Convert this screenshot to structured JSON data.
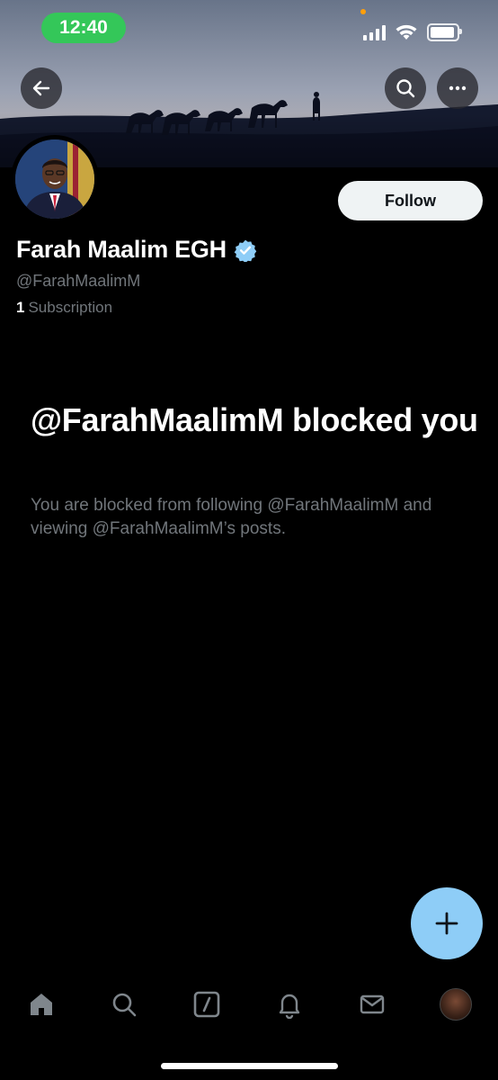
{
  "status_bar": {
    "time": "12:40",
    "icons": [
      "cellular-signal-icon",
      "wifi-icon",
      "battery-icon"
    ],
    "time_pill_color": "#34c759"
  },
  "header": {
    "back_icon": "arrow-left-icon",
    "search_icon": "search-icon",
    "more_icon": "more-horizontal-icon"
  },
  "profile": {
    "display_name": "Farah Maalim EGH",
    "handle": "@FarahMaalimM",
    "verified": true,
    "subscription_count": "1",
    "subscription_label": "Subscription",
    "follow_label": "Follow"
  },
  "blocked": {
    "title": "@FarahMaalimM blocked you",
    "description": "You are blocked from following @FarahMaalimM and viewing @FarahMaalimM’s posts."
  },
  "fab": {
    "icon": "plus-icon",
    "color": "#8ecdf7"
  },
  "tabbar": {
    "items": [
      "home-icon",
      "search-icon",
      "grok-icon",
      "notifications-icon",
      "messages-icon",
      "profile-avatar"
    ]
  },
  "colors": {
    "background": "#000000",
    "secondary_text": "#71767b",
    "verified_badge": "#8ecdf7"
  }
}
